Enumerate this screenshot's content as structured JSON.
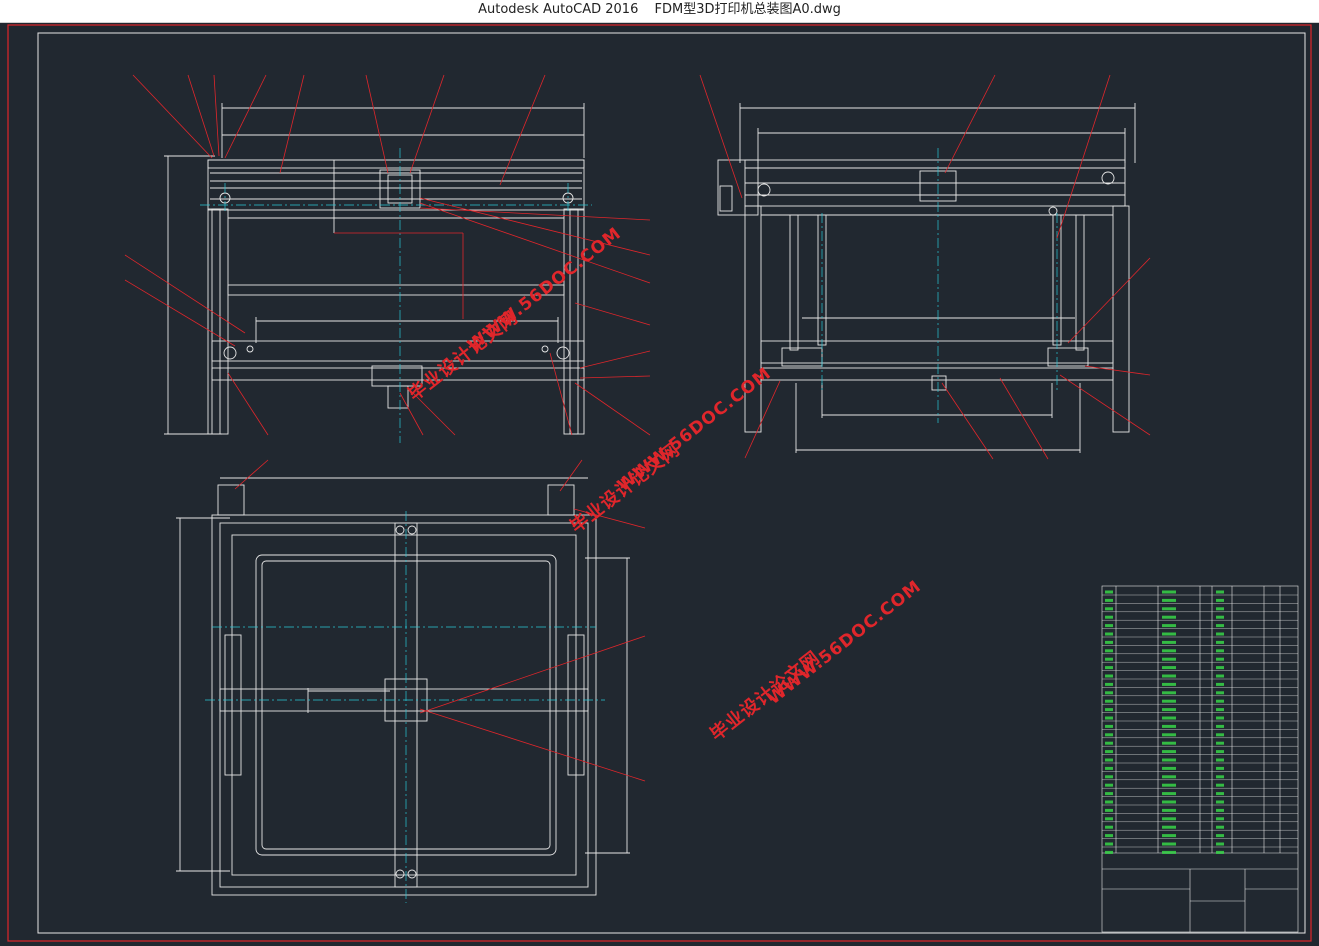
{
  "window": {
    "app_title": "Autodesk AutoCAD 2016",
    "document_title": "FDM型3D打印机总装图A0.dwg"
  },
  "watermarks": [
    {
      "url": "WWW.56DOC.COM",
      "cn": "毕业设计论文网"
    },
    {
      "url": "WWW.56DOC.COM",
      "cn": "毕业设计论文网"
    },
    {
      "url": "WWW.56DOC.COM",
      "cn": "毕业设计论文网"
    }
  ],
  "colors": {
    "background": "#212830",
    "frame": "#e0262b",
    "geometry": "#e6e6e6",
    "centerline": "#29c6d6",
    "leader": "#e0262b",
    "text": "#39e04a"
  }
}
